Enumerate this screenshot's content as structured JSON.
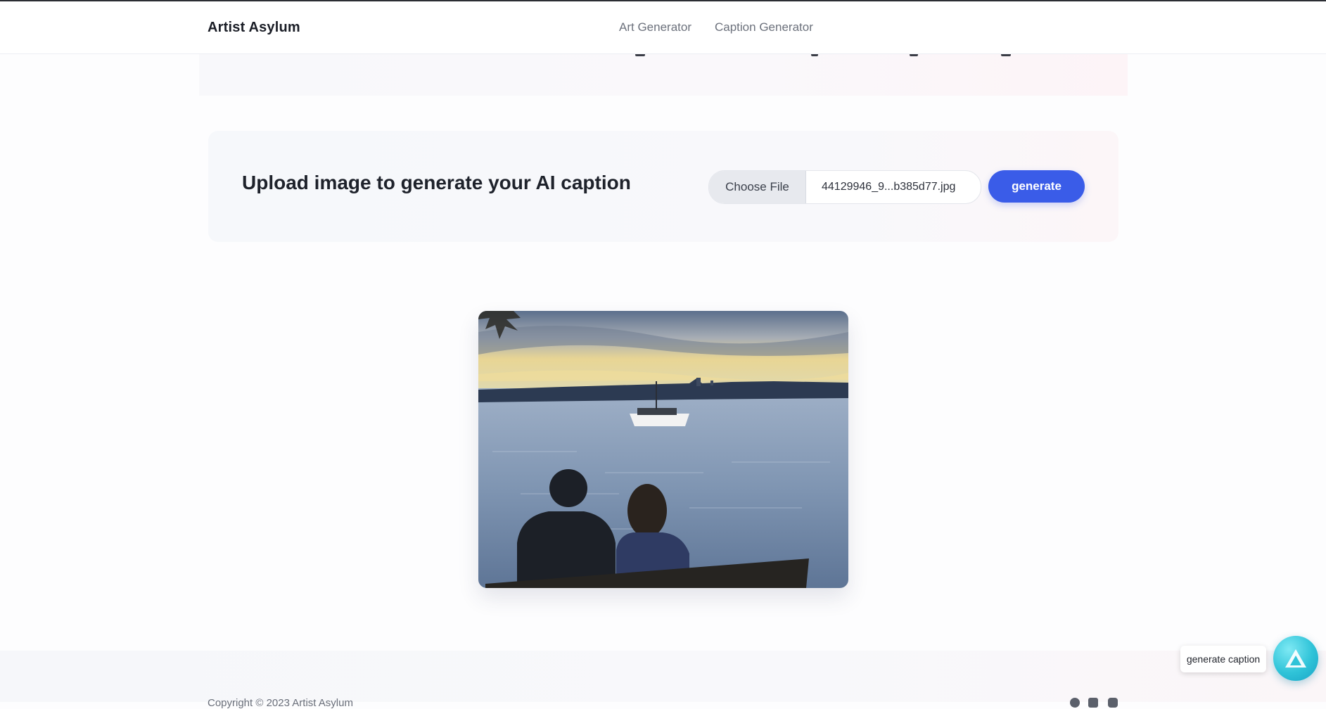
{
  "header": {
    "brand": "Artist Asylum",
    "nav": [
      {
        "label": "Art Generator"
      },
      {
        "label": "Caption Generator"
      }
    ]
  },
  "upload": {
    "title": "Upload image to generate your AI caption",
    "choose_file_label": "Choose File",
    "file_name": "44129946_9...b385d77.jpg",
    "generate_label": "generate"
  },
  "footer": {
    "copyright": "Copyright © 2023 Artist Asylum"
  },
  "widget": {
    "tooltip": "generate caption",
    "icon": "assistant-logo-icon"
  },
  "colors": {
    "accent": "#3a5ce8",
    "fab": "#2fc3d8"
  }
}
